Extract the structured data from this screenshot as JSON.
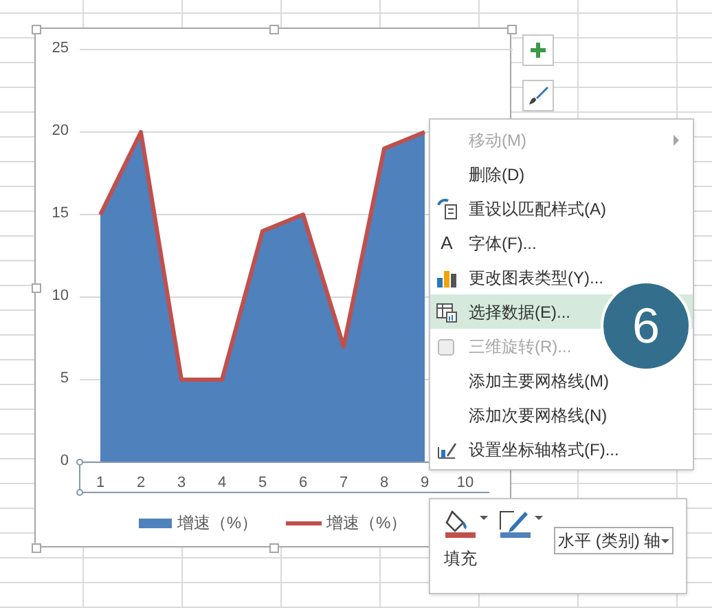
{
  "chart": {
    "chart_data": {
      "type": "area",
      "categories": [
        "1",
        "2",
        "3",
        "4",
        "5",
        "6",
        "7",
        "8",
        "9",
        "10"
      ],
      "ylim": [
        0,
        25
      ],
      "yticks": [
        0,
        5,
        10,
        15,
        20,
        25
      ],
      "grid": true,
      "series": [
        {
          "name": "增速（%）",
          "type": "area",
          "color": "#4f81bd",
          "values": [
            15,
            20,
            5,
            5,
            14,
            15,
            7,
            19,
            20,
            null
          ]
        },
        {
          "name": "增速（%）",
          "type": "line",
          "color": "#c0504d",
          "values": [
            15,
            20,
            5,
            5,
            14,
            15,
            7,
            19,
            20,
            null
          ]
        }
      ]
    }
  },
  "context_menu": [
    {
      "label": "移动(M)",
      "kind": "plain",
      "disabled": true,
      "submenu": true,
      "selected": false
    },
    {
      "label": "删除(D)",
      "kind": "plain",
      "disabled": false,
      "submenu": false,
      "selected": false
    },
    {
      "label": "重设以匹配样式(A)",
      "kind": "reset-style",
      "disabled": false,
      "submenu": false,
      "selected": false
    },
    {
      "label": "字体(F)...",
      "kind": "font",
      "glyph": "A",
      "disabled": false,
      "submenu": false,
      "selected": false
    },
    {
      "label": "更改图表类型(Y)...",
      "kind": "chart-type",
      "disabled": false,
      "submenu": false,
      "selected": false
    },
    {
      "label": "选择数据(E)...",
      "kind": "select-data",
      "disabled": false,
      "submenu": false,
      "selected": true
    },
    {
      "label": "三维旋转(R)...",
      "kind": "rotate",
      "disabled": true,
      "submenu": false,
      "selected": false
    },
    {
      "label": "添加主要网格线(M)",
      "kind": "plain",
      "disabled": false,
      "submenu": false,
      "selected": false
    },
    {
      "label": "添加次要网格线(N)",
      "kind": "plain",
      "disabled": false,
      "submenu": false,
      "selected": false
    },
    {
      "label": "设置坐标轴格式(F)...",
      "kind": "axis-format",
      "disabled": false,
      "submenu": false,
      "selected": false
    }
  ],
  "step_badge": "6",
  "mini_toolbar": {
    "fill_label": "填充",
    "element_dropdown": "水平 (类别) 轴"
  }
}
